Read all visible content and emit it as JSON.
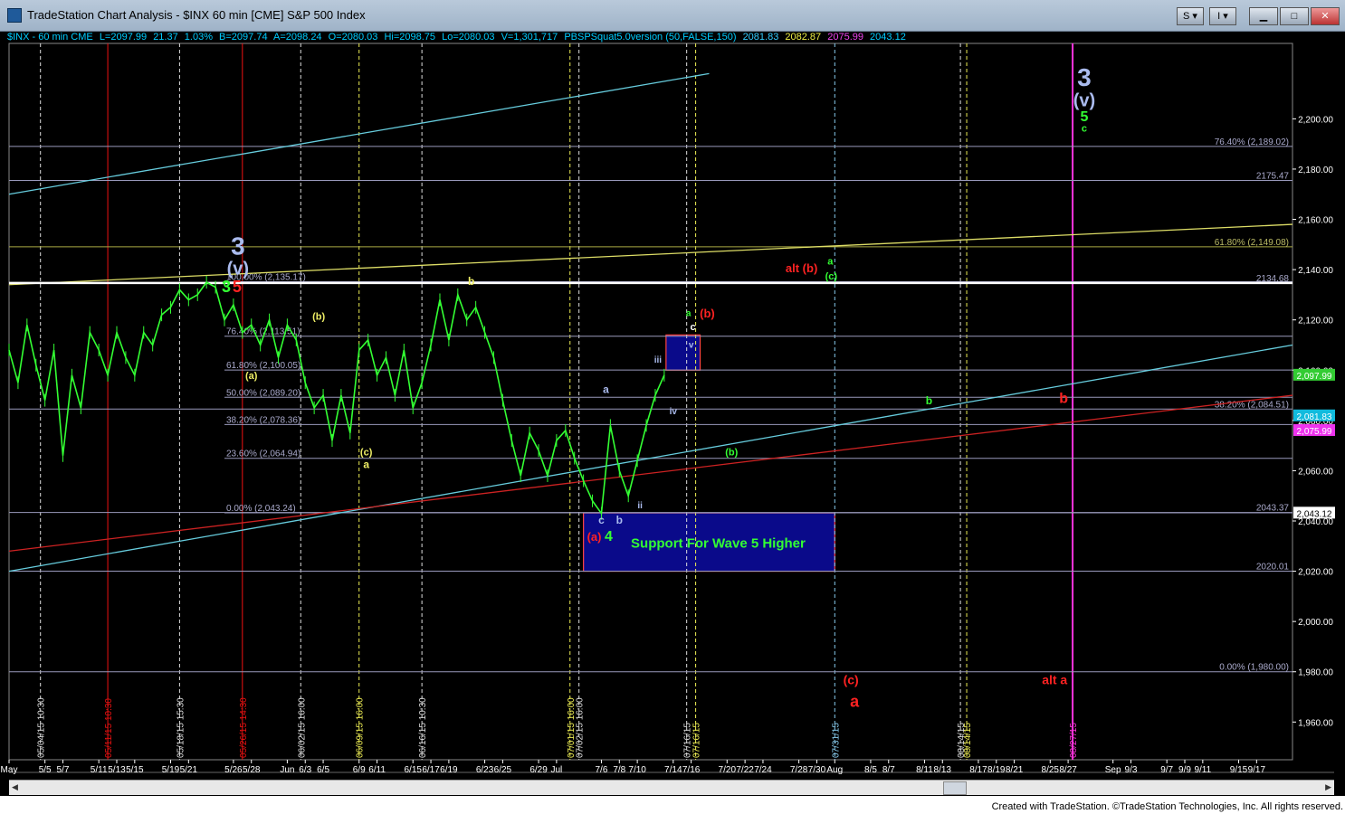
{
  "window": {
    "title": "TradeStation Chart Analysis - $INX 60 min [CME] S&P 500 Index",
    "buttons": {
      "s": "S",
      "i": "I"
    }
  },
  "info": {
    "symbol": "$INX - 60 min  CME",
    "last": "L=2097.99",
    "change": "21.37",
    "pct": "1.03%",
    "bid": "B=2097.74",
    "ask": "A=2098.24",
    "open": "O=2080.03",
    "high": "Hi=2098.75",
    "low": "Lo=2080.03",
    "volume": "V=1,301,717",
    "indicator": "PBSPSquat5.0version (50,FALSE,150)",
    "vals": [
      "2081.83",
      "2082.87",
      "2075.99",
      "2043.12"
    ]
  },
  "colors": {
    "bg": "#000000",
    "grid": "#ffffff",
    "price": "#33ff33",
    "cyan": "#66ccdd",
    "red": "#dd1111",
    "yellow": "#eeee66",
    "magenta": "#ff33cc",
    "blue_box": "#0a0a8a",
    "fib": "#aaaacc",
    "label_blue": "#aabbee"
  },
  "chart_data": {
    "type": "line",
    "title": "$INX 60 min",
    "ylim": [
      1945,
      2230
    ],
    "yticks": [
      1960,
      1980,
      2000,
      2020,
      2040,
      2060,
      2080,
      2100,
      2120,
      2140,
      2160,
      2180,
      2200
    ],
    "ytick_labels": [
      "1,960.00",
      "1,980.00",
      "2,000.00",
      "2,020.00",
      "2,040.00",
      "2,060.00",
      "2,080.00",
      "2,100.00",
      "2,120.00",
      "2,140.00",
      "2,160.00",
      "2,180.00",
      "2,200.00"
    ],
    "x_labels": [
      "May",
      "5/5",
      "5/7",
      "5/11",
      "5/13",
      "5/15",
      "5/19",
      "5/21",
      "5/26",
      "5/28",
      "Jun",
      "6/3",
      "6/5",
      "6/9",
      "6/11",
      "6/15",
      "6/17",
      "6/19",
      "6/23",
      "6/25",
      "6/29",
      "Jul",
      "7/6",
      "7/8",
      "7/10",
      "7/14",
      "7/16",
      "7/20",
      "7/22",
      "7/24",
      "7/28",
      "7/30",
      "Aug",
      "8/5",
      "8/7",
      "8/11",
      "8/13",
      "8/17",
      "8/19",
      "8/21",
      "8/25",
      "8/27",
      "Sep",
      "9/3",
      "9/7",
      "9/9",
      "9/11",
      "9/15",
      "9/17"
    ],
    "x_days": [
      0,
      4,
      6,
      10,
      12,
      14,
      18,
      20,
      25,
      27,
      31,
      33,
      35,
      39,
      41,
      45,
      47,
      49,
      53,
      55,
      59,
      61,
      66,
      68,
      70,
      74,
      76,
      80,
      82,
      84,
      88,
      90,
      92,
      96,
      98,
      102,
      104,
      108,
      110,
      112,
      116,
      118,
      123,
      125,
      129,
      131,
      133,
      137,
      139
    ],
    "xlim": [
      0,
      143
    ],
    "price_series": {
      "name": "$INX",
      "x": [
        0,
        1,
        2,
        3,
        4,
        5,
        6,
        7,
        8,
        9,
        10,
        11,
        12,
        13,
        14,
        15,
        16,
        17,
        18,
        19,
        20,
        21,
        22,
        23,
        24,
        25,
        26,
        27,
        28,
        29,
        30,
        31,
        32,
        33,
        34,
        35,
        36,
        37,
        38,
        39,
        40,
        41,
        42,
        43,
        44,
        45,
        46,
        47,
        48,
        49,
        50,
        51,
        52,
        53,
        54,
        55,
        56,
        57,
        58,
        59,
        60,
        61,
        62,
        63,
        64,
        65,
        66,
        67,
        68,
        69,
        70,
        71,
        72,
        73
      ],
      "y": [
        2108,
        2095,
        2118,
        2102,
        2088,
        2108,
        2066,
        2098,
        2085,
        2115,
        2108,
        2098,
        2115,
        2105,
        2098,
        2115,
        2110,
        2122,
        2125,
        2132,
        2128,
        2130,
        2135,
        2133,
        2120,
        2126,
        2115,
        2118,
        2110,
        2120,
        2105,
        2118,
        2112,
        2095,
        2085,
        2090,
        2072,
        2090,
        2075,
        2108,
        2112,
        2098,
        2105,
        2090,
        2108,
        2085,
        2095,
        2110,
        2128,
        2112,
        2130,
        2120,
        2125,
        2115,
        2105,
        2088,
        2072,
        2058,
        2075,
        2068,
        2058,
        2072,
        2076,
        2065,
        2056,
        2048,
        2043,
        2078,
        2060,
        2050,
        2064,
        2078,
        2090,
        2098
      ]
    },
    "series": [
      {
        "name": "upper-cyan-channel",
        "x": [
          0,
          78
        ],
        "y": [
          2170,
          2218
        ]
      },
      {
        "name": "lower-cyan-channel",
        "x": [
          0,
          143
        ],
        "y": [
          2020,
          2110
        ]
      },
      {
        "name": "red-trendline",
        "x": [
          0,
          143
        ],
        "y": [
          2028,
          2090
        ]
      },
      {
        "name": "yellow-trendline",
        "x": [
          0,
          143
        ],
        "y": [
          2134,
          2158
        ]
      }
    ],
    "horizontal_levels": [
      {
        "label": "76.40% (2,189.02)",
        "y": 2189.02,
        "x0": 0,
        "x1": 143
      },
      {
        "label": "2175.47",
        "y": 2175.47,
        "x0": 0,
        "x1": 143
      },
      {
        "label": "61.80% (2,149.08)",
        "y": 2149.08,
        "x0": 0,
        "x1": 143
      },
      {
        "label": "2134.68",
        "y": 2134.68,
        "x0": 0,
        "x1": 143
      },
      {
        "label": "100.00% (2,135.17)",
        "y": 2135.17,
        "x0": 24,
        "x1": 143
      },
      {
        "label": "76.40% (2,113.51)",
        "y": 2113.51,
        "x0": 24,
        "x1": 143
      },
      {
        "label": "61.80% (2,100.05)",
        "y": 2100.05,
        "x0": 24,
        "x1": 143
      },
      {
        "label": "50.00% (2,089.20)",
        "y": 2089.2,
        "x0": 24,
        "x1": 143
      },
      {
        "label": "38.20% (2,084.51)",
        "y": 2084.51,
        "x0": 0,
        "x1": 143
      },
      {
        "label": "38.20% (2,078.36)",
        "y": 2078.36,
        "x0": 24,
        "x1": 143
      },
      {
        "label": "23.60% (2,064.94)",
        "y": 2064.94,
        "x0": 24,
        "x1": 143
      },
      {
        "label": "0.00% (2,043.24)",
        "y": 2043.24,
        "x0": 24,
        "x1": 143
      },
      {
        "label": "2043.37",
        "y": 2043.37,
        "x0": 0,
        "x1": 143
      },
      {
        "label": "2020.01",
        "y": 2020.01,
        "x0": 0,
        "x1": 143
      },
      {
        "label": "0.00% (1,980.00)",
        "y": 1980.0,
        "x0": 0,
        "x1": 143
      }
    ],
    "vertical_lines": [
      {
        "label": "05/04/15 10:30",
        "x": 3.5,
        "color": "white"
      },
      {
        "label": "05/11/15 10:30",
        "x": 11,
        "color": "red"
      },
      {
        "label": "05/18/15 15:30",
        "x": 19,
        "color": "white"
      },
      {
        "label": "05/26/15 14:30",
        "x": 26,
        "color": "red"
      },
      {
        "label": "06/02/15 16:00",
        "x": 32.5,
        "color": "white"
      },
      {
        "label": "06/09/15 16:00",
        "x": 39,
        "color": "yellow"
      },
      {
        "label": "06/16/15 10:30",
        "x": 46,
        "color": "white"
      },
      {
        "label": "07/01/15 16:00",
        "x": 62.5,
        "color": "yellow"
      },
      {
        "label": "07/02/15 16:00",
        "x": 63.5,
        "color": "white"
      },
      {
        "label": "07/16/15",
        "x": 75.5,
        "color": "white"
      },
      {
        "label": "07/16/15",
        "x": 76.5,
        "color": "yellow"
      },
      {
        "label": "07/31/15",
        "x": 92,
        "color": "cyan"
      },
      {
        "label": "08/14/15",
        "x": 106,
        "color": "white"
      },
      {
        "label": "08/14/15",
        "x": 106.7,
        "color": "yellow"
      },
      {
        "label": "08/27/15",
        "x": 118.5,
        "color": "magenta"
      }
    ],
    "boxes": [
      {
        "name": "support-box",
        "label": "Support For Wave 5 Higher",
        "x0": 64,
        "x1": 92,
        "y0": 2020,
        "y1": 2043.2
      },
      {
        "name": "target-box",
        "label": "",
        "x0": 73.2,
        "x1": 77,
        "y0": 2100,
        "y1": 2114
      }
    ],
    "right_tags": [
      {
        "text": "2,097.99",
        "y": 2097.99,
        "color": "#33cc33"
      },
      {
        "text": "2,081.83",
        "y": 2081.83,
        "color": "#11bbdd"
      },
      {
        "text": "2,075.99",
        "y": 2075.99,
        "color": "#ee33ee"
      },
      {
        "text": "2,043.12",
        "y": 2043.12,
        "color": "#ffffff"
      }
    ],
    "annotations": [
      {
        "text": "3",
        "x": 25.5,
        "y": 2146,
        "color": "#aabbee",
        "size": 28
      },
      {
        "text": "(v)",
        "x": 25.5,
        "y": 2138,
        "color": "#aabbee",
        "size": 20
      },
      {
        "text": "3",
        "x": 24.2,
        "y": 2131,
        "color": "#33ff33",
        "size": 18
      },
      {
        "text": "5",
        "x": 25.4,
        "y": 2131,
        "color": "#ff2222",
        "size": 18
      },
      {
        "text": "c",
        "x": 24.2,
        "y": 2133,
        "color": "#33ff33",
        "size": 11
      },
      {
        "text": "(b)",
        "x": 34.5,
        "y": 2120,
        "color": "#eeee66",
        "size": 11
      },
      {
        "text": "(a)",
        "x": 27,
        "y": 2096.5,
        "color": "#eeee66",
        "size": 11
      },
      {
        "text": "(c)",
        "x": 39.8,
        "y": 2066,
        "color": "#eeee66",
        "size": 11
      },
      {
        "text": "a",
        "x": 39.8,
        "y": 2061,
        "color": "#eeee66",
        "size": 12
      },
      {
        "text": "b",
        "x": 51.5,
        "y": 2134,
        "color": "#eeee66",
        "size": 12
      },
      {
        "text": "a",
        "x": 66.5,
        "y": 2091,
        "color": "#aabbee",
        "size": 12
      },
      {
        "text": "c",
        "x": 66,
        "y": 2039,
        "color": "#aabbee",
        "size": 12
      },
      {
        "text": "b",
        "x": 68,
        "y": 2039,
        "color": "#aabbee",
        "size": 12
      },
      {
        "text": "ii",
        "x": 70.3,
        "y": 2045,
        "color": "#aabbee",
        "size": 10
      },
      {
        "text": "iii",
        "x": 72.3,
        "y": 2103,
        "color": "#aabbee",
        "size": 10
      },
      {
        "text": "iv",
        "x": 74,
        "y": 2082.5,
        "color": "#aabbee",
        "size": 10
      },
      {
        "text": "v",
        "x": 76,
        "y": 2109,
        "color": "#aabbee",
        "size": 10
      },
      {
        "text": "c",
        "x": 76.2,
        "y": 2116,
        "color": "#ffffff",
        "size": 11
      },
      {
        "text": "a",
        "x": 75.7,
        "y": 2121.5,
        "color": "#33ff33",
        "size": 10
      },
      {
        "text": "(b)",
        "x": 77.8,
        "y": 2121,
        "color": "#ff2222",
        "size": 13
      },
      {
        "text": "(a)",
        "x": 65.2,
        "y": 2032,
        "color": "#ff2222",
        "size": 13
      },
      {
        "text": "4",
        "x": 66.8,
        "y": 2032,
        "color": "#33ff33",
        "size": 16
      },
      {
        "text": "(b)",
        "x": 80.5,
        "y": 2066,
        "color": "#33ff33",
        "size": 11
      },
      {
        "text": "b",
        "x": 102.5,
        "y": 2086.5,
        "color": "#33ff33",
        "size": 12
      },
      {
        "text": "alt (b)",
        "x": 88.3,
        "y": 2139,
        "color": "#ff2222",
        "size": 13
      },
      {
        "text": "a",
        "x": 91.5,
        "y": 2142,
        "color": "#33ff33",
        "size": 11
      },
      {
        "text": "(c)",
        "x": 91.6,
        "y": 2136,
        "color": "#33ff33",
        "size": 11
      },
      {
        "text": "3",
        "x": 119.8,
        "y": 2213,
        "color": "#aabbee",
        "size": 28
      },
      {
        "text": "(v)",
        "x": 119.8,
        "y": 2205,
        "color": "#aabbee",
        "size": 20
      },
      {
        "text": "5",
        "x": 119.8,
        "y": 2199,
        "color": "#33ff33",
        "size": 16
      },
      {
        "text": "c",
        "x": 119.8,
        "y": 2195,
        "color": "#33ff33",
        "size": 11
      },
      {
        "text": "b",
        "x": 117.5,
        "y": 2087,
        "color": "#ff2222",
        "size": 16
      },
      {
        "text": "(c)",
        "x": 93.8,
        "y": 1975,
        "color": "#ff2222",
        "size": 14
      },
      {
        "text": "a",
        "x": 94.2,
        "y": 1966,
        "color": "#ff2222",
        "size": 18
      },
      {
        "text": "alt a",
        "x": 116.5,
        "y": 1975,
        "color": "#ff2222",
        "size": 14
      }
    ]
  },
  "footer": {
    "credit": "Created with TradeStation. ©TradeStation Technologies, Inc. All rights reserved."
  }
}
